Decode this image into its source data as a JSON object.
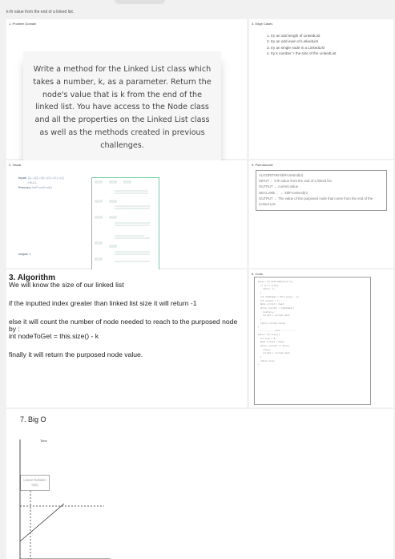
{
  "board": {
    "title": "k-th value from the end of a linked list."
  },
  "problem_domain": {
    "label": "1. Problem Domain",
    "text": "Write a method for the Linked List class which takes a number, k, as a parameter. Return the node's value that is k from the end of the linked list. You have access to the Node class and all the properties on the Linked List class as well as the methods created in previous challenges."
  },
  "edge_cases": {
    "label": "4. Edge Cases",
    "items": [
      "1. try an odd length of LinkedList",
      "2. try an odd even of LinkedList",
      "3. try an single node in a LinkedList",
      "4. try k number > the size of the LinkedList"
    ]
  },
  "visual": {
    "label": "2. Visual",
    "input_label": "Input:",
    "input_value": "{1}->{2}->{3}->{2}->{1}->{1}",
    "null_text": "->NULL",
    "process_label": "Process:",
    "process_value": "kthFromEnd(k)",
    "output_label": "output:",
    "output_value": "3"
  },
  "pseudocode": {
    "label": "5. Pseudocode",
    "lines": [
      "ALGORITHM kthFromEnd(n)",
      "INPUT ← k-th value from the end of a linked list",
      "OUTPUT ← current.value",
      "DECLARE ← ← kthFromEnd(n)",
      "OUTPUT ← The value of the purposed node that come from the end of the Linked List."
    ]
  },
  "algorithm": {
    "title": "3. Algorithm",
    "paragraphs": [
      "We will know the size of our linked list",
      "if the inputted index greater than linked list size it will return -1",
      "else it will count the number of node needed to reach to the purposed node by :",
      "int nodeToGet = this.size() - k",
      "finally it will return the purposed node value."
    ]
  },
  "code": {
    "label": "6. Code",
    "lines": [
      "public int kthFromEnd(int k){",
      "  if (k >= size){",
      "    return -1;",
      "  }",
      "  int nodeToGet = this.size() - k;",
      "  int counter = 1;",
      "  Node current = head;",
      "  while (counter < nodeToGet){",
      "    counter++;",
      "    current = current.next;",
      "  }",
      "  return current.value;",
      "}",
      "",
      "------------- size -------------",
      "",
      "public int size(){",
      "  int size = 0;",
      "  Node current = head;",
      "  while (current != null){",
      "    size++;",
      "    current = current.next;",
      "  }",
      "  return size;",
      "}"
    ]
  },
  "big_o": {
    "title": "7. Big O",
    "time_label": "Time",
    "relation_label": "Linear Relation",
    "relation_value": "O(n)"
  }
}
